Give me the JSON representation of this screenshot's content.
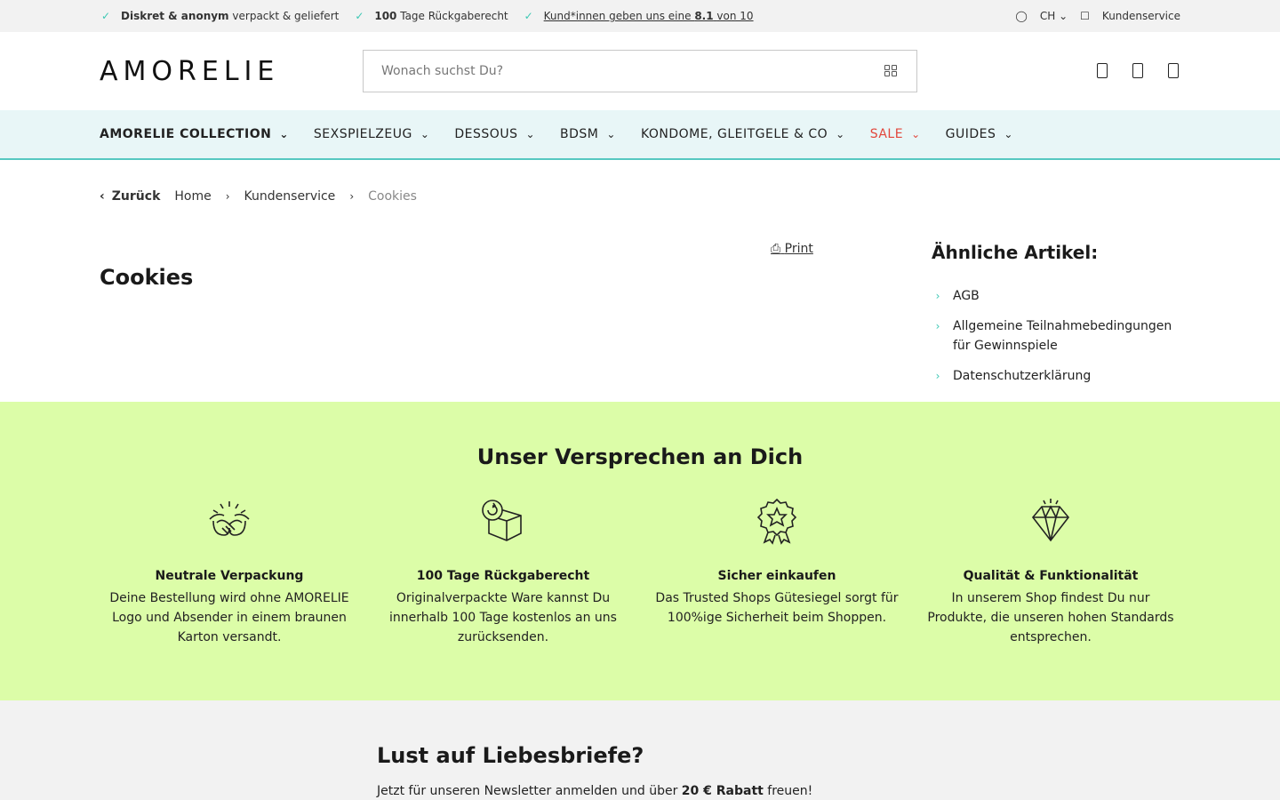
{
  "topbar": {
    "usps": [
      {
        "bold": "Diskret & anonym",
        "text": "verpackt & geliefert"
      },
      {
        "bold": "100",
        "text": "Tage Rückgaberecht"
      },
      {
        "link_pre": "Kund*innen geben uns eine",
        "link_bold": "8.1",
        "link_post": "von 10"
      }
    ],
    "country": "CH",
    "service": "Kundenservice"
  },
  "header": {
    "logo": "AMORELIE",
    "search_placeholder": "Wonach suchst Du?"
  },
  "nav": [
    {
      "label": "AMORELIE COLLECTION"
    },
    {
      "label": "SEXSPIELZEUG"
    },
    {
      "label": "DESSOUS"
    },
    {
      "label": "BDSM"
    },
    {
      "label": "KONDOME, GLEITGELE & CO"
    },
    {
      "label": "SALE"
    },
    {
      "label": "GUIDES"
    }
  ],
  "breadcrumb": {
    "back": "Zurück",
    "items": [
      "Home",
      "Kundenservice",
      "Cookies"
    ]
  },
  "content": {
    "print": "Print",
    "title": "Cookies"
  },
  "related": {
    "title": "Ähnliche Artikel:",
    "items": [
      "AGB",
      "Allgemeine Teilnahmebedingungen für Gewinnspiele",
      "Datenschutzerklärung"
    ]
  },
  "promise": {
    "title": "Unser Versprechen an Dich",
    "items": [
      {
        "icon": "handshake-icon",
        "title": "Neutrale Verpackung",
        "text": "Deine Bestellung wird ohne AMORELIE Logo und Absender in einem braunen Karton versandt."
      },
      {
        "icon": "box-return-icon",
        "title": "100 Tage Rückgaberecht",
        "text": "Originalverpackte Ware kannst Du innerhalb 100 Tage kostenlos an uns zurücksenden."
      },
      {
        "icon": "badge-star-icon",
        "title": "Sicher einkaufen",
        "text": "Das Trusted Shops Gütesiegel sorgt für 100%ige Sicherheit beim Shoppen."
      },
      {
        "icon": "diamond-icon",
        "title": "Qualität & Funktionalität",
        "text": "In unserem Shop findest Du nur Produkte, die unseren hohen Standards entsprechen."
      }
    ]
  },
  "newsletter": {
    "title": "Lust auf Liebesbriefe?",
    "text_pre": "Jetzt für unseren Newsletter anmelden und über",
    "text_bold": "20 € Rabatt",
    "text_post": "freuen!"
  },
  "colors": {
    "accent": "#3cc8b4",
    "sale": "#e2463b",
    "promise_bg": "#dcfda8",
    "nav_bg": "#e8f6f7"
  }
}
